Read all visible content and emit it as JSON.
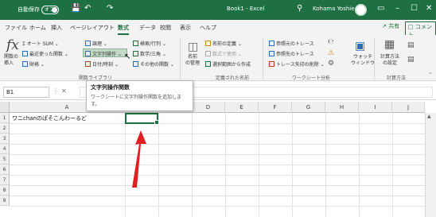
{
  "title_bar": {
    "autosave_label": "自動保存",
    "autosave_toggle": "オフ",
    "save_icon": "save-icon",
    "undo_icon": "undo-icon",
    "redo_icon": "redo-icon",
    "doc_title": "Book1 - Excel",
    "search_icon": "search-icon",
    "user_name": "Kohama Yoshie",
    "window_controls": [
      "▭",
      "–",
      "☐",
      "✕"
    ]
  },
  "tabs": [
    "ファイル",
    "ホーム",
    "挿入",
    "ページレイアウト",
    "数式",
    "データ",
    "校閲",
    "表示",
    "ヘルプ"
  ],
  "active_tab": "数式",
  "share_label": "共有",
  "comment_label": "コメント",
  "ribbon": {
    "insert_function": "関数の\n挿入",
    "autosum": "オート SUM",
    "recent": "最近使った関数",
    "financial": "財務",
    "logical": "論理",
    "text": "文字列操作",
    "datetime": "日付/時刻",
    "lookup": "検索/行列",
    "math": "数学/三角",
    "more": "その他の関数",
    "group_library": "関数ライブラリ",
    "name_manager": "名前\nの管理",
    "define_name": "名前の定義",
    "use_in_formula": "数式で使用",
    "create_from_selection": "選択範囲から作成",
    "group_names": "定義された名前",
    "trace_precedents": "参照元のトレース",
    "trace_dependents": "参照先のトレース",
    "remove_arrows": "トレース矢印の削除",
    "group_audit": "ワークシート分析",
    "watch_window": "ウォッチ\nウィンドウ",
    "calc_options": "計算方法\nの設定",
    "group_calc": "計算方法"
  },
  "tooltip": {
    "title": "文字列操作関数",
    "body": "ワークシートに文字列操作関数を追加します。"
  },
  "formula_bar": {
    "name_box": "B1",
    "formula": ""
  },
  "grid": {
    "columns": [
      "A",
      "B",
      "C",
      "D",
      "E",
      "F",
      "G",
      "H",
      "I",
      "J"
    ],
    "rows": [
      "1",
      "2",
      "3",
      "4",
      "5",
      "6",
      "7",
      "8",
      "9"
    ],
    "a1_value": "ワニchanのぱそこんわーるど",
    "selected_cell": "B1"
  },
  "colors": {
    "excel_green": "#1e6f42",
    "annotation_arrow": "#e02020"
  }
}
